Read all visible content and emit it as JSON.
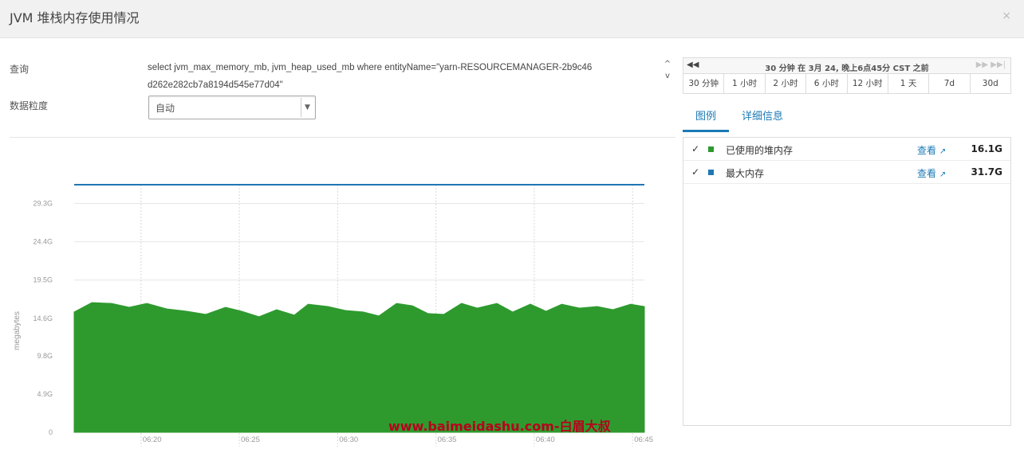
{
  "dialog": {
    "title": "JVM 堆栈内存使用情况",
    "close_icon": "×"
  },
  "form": {
    "query_label": "查询",
    "query_text": "select jvm_max_memory_mb, jvm_heap_used_mb where entityName=\"yarn-RESOURCEMANAGER-2b9c46d262e282cb7a8194d545e77d04\"",
    "granularity_label": "数据粒度",
    "granularity_value": "自动",
    "scroll_up": "^",
    "scroll_down": "v"
  },
  "time": {
    "rewind_icon": "◀◀",
    "description": "30 分钟 在 3月 24, 晚上6点45分 CST 之前",
    "forward_icon": "▶▶  ▶▶|",
    "ranges": [
      "30 分钟",
      "1 小时",
      "2 小时",
      "6 小时",
      "12 小时",
      "1 天",
      "7d",
      "30d"
    ]
  },
  "tabs": [
    "图例",
    "详细信息"
  ],
  "legend": [
    {
      "check": "✓",
      "name": "已使用的堆内存",
      "link": "查看",
      "value": "16.1G",
      "color": "#2e9a2e"
    },
    {
      "check": "✓",
      "name": "最大内存",
      "link": "查看",
      "value": "31.7G",
      "color": "#1f77b4"
    }
  ],
  "chart_data": {
    "type": "area",
    "ylabel": "megabytes",
    "y_ticks": [
      "0",
      "4.9G",
      "9.8G",
      "14.6G",
      "19.5G",
      "24.4G",
      "29.3G"
    ],
    "y_tick_values": [
      0,
      4.9,
      9.8,
      14.6,
      19.5,
      24.4,
      29.3
    ],
    "ylim": [
      0,
      31.7
    ],
    "x_ticks": [
      "06:20",
      "06:25",
      "06:30",
      "06:35",
      "06:40",
      "06:45"
    ],
    "x_tick_minutes": [
      20,
      25,
      30,
      35,
      40,
      45
    ],
    "xlim_minutes": [
      16.6,
      45.6
    ],
    "grid": true,
    "series": [
      {
        "name": "已使用的堆内存",
        "color": "#2e9a2e",
        "kind": "area",
        "x_minutes": [
          16.6,
          17.5,
          18.5,
          19.4,
          20.3,
          21.3,
          22.3,
          23.3,
          24.3,
          25.1,
          26.0,
          26.9,
          27.8,
          28.5,
          29.5,
          30.4,
          31.3,
          32.1,
          33.0,
          33.8,
          34.6,
          35.4,
          36.3,
          37.1,
          38.1,
          38.9,
          39.8,
          40.6,
          41.4,
          42.3,
          43.2,
          44.0,
          44.9,
          45.6
        ],
        "values": [
          15.4,
          16.6,
          16.5,
          16.0,
          16.5,
          15.8,
          15.5,
          15.1,
          16.0,
          15.5,
          14.8,
          15.7,
          15.0,
          16.4,
          16.1,
          15.6,
          15.4,
          14.9,
          16.5,
          16.2,
          15.2,
          15.1,
          16.5,
          15.9,
          16.5,
          15.4,
          16.4,
          15.5,
          16.4,
          15.9,
          16.1,
          15.7,
          16.4,
          16.1
        ]
      },
      {
        "name": "最大内存",
        "color": "#1f77b4",
        "kind": "line",
        "x_minutes": [
          16.6,
          45.6
        ],
        "values": [
          31.7,
          31.7
        ]
      }
    ]
  },
  "watermark": "www.baimeidashu.com-白眉大叔"
}
